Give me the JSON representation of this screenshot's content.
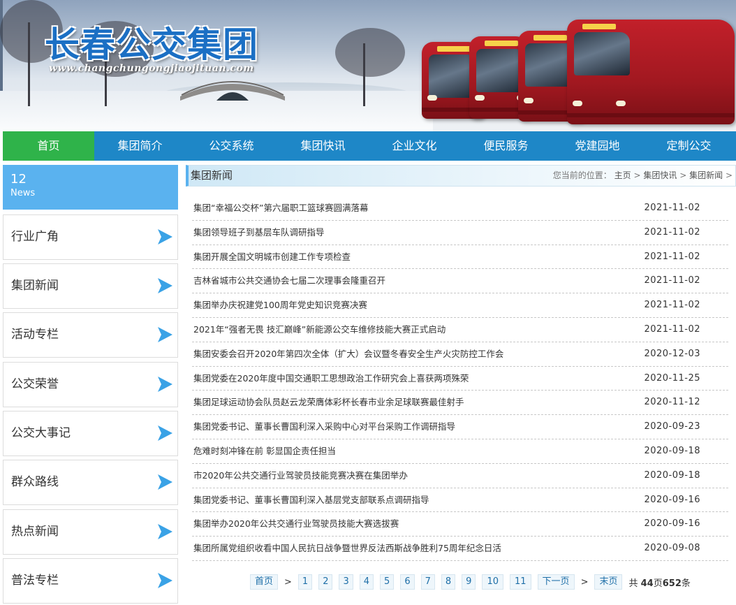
{
  "banner": {
    "logo_text": "长春公交集团",
    "url_text": "www.changchungongjiaojituan.com"
  },
  "nav": {
    "items": [
      {
        "label": "首页",
        "active": true
      },
      {
        "label": "集团简介",
        "active": false
      },
      {
        "label": "公交系统",
        "active": false
      },
      {
        "label": "集团快讯",
        "active": false
      },
      {
        "label": "企业文化",
        "active": false
      },
      {
        "label": "便民服务",
        "active": false
      },
      {
        "label": "党建园地",
        "active": false
      },
      {
        "label": "定制公交",
        "active": false
      }
    ],
    "active_color": "#2fb34a",
    "bar_color": "#1e87c7"
  },
  "sidebar": {
    "head_number": "12",
    "head_sub": "News",
    "items": [
      {
        "label": "行业广角",
        "icon": "arrow-right-icon"
      },
      {
        "label": "集团新闻",
        "icon": "arrow-right-icon"
      },
      {
        "label": "活动专栏",
        "icon": "arrow-right-icon"
      },
      {
        "label": "公交荣誉",
        "icon": "arrow-right-icon"
      },
      {
        "label": "公交大事记",
        "icon": "arrow-right-icon"
      },
      {
        "label": "群众路线",
        "icon": "arrow-right-icon"
      },
      {
        "label": "热点新闻",
        "icon": "arrow-right-icon"
      },
      {
        "label": "普法专栏",
        "icon": "arrow-right-icon"
      }
    ]
  },
  "main": {
    "title": "集团新闻",
    "breadcrumb": {
      "prefix": "您当前的位置：",
      "items": [
        "主页",
        "集团快讯",
        "集团新闻"
      ],
      "separator": ">"
    },
    "news": [
      {
        "title": "集团“幸福公交杯”第六届职工篮球赛圆满落幕",
        "date": "2021-11-02"
      },
      {
        "title": "集团领导班子到基层车队调研指导",
        "date": "2021-11-02"
      },
      {
        "title": "集团开展全国文明城市创建工作专项检查",
        "date": "2021-11-02"
      },
      {
        "title": "吉林省城市公共交通协会七届二次理事会隆重召开",
        "date": "2021-11-02"
      },
      {
        "title": "集团举办庆祝建党100周年党史知识竞赛决赛",
        "date": "2021-11-02"
      },
      {
        "title": "2021年“强者无畏 技汇巅峰”新能源公交车维修技能大赛正式启动",
        "date": "2021-11-02"
      },
      {
        "title": "集团安委会召开2020年第四次全体（扩大）会议暨冬春安全生产火灾防控工作会",
        "date": "2020-12-03"
      },
      {
        "title": "集团党委在2020年度中国交通职工思想政治工作研究会上喜获两项殊荣",
        "date": "2020-11-25"
      },
      {
        "title": "集团足球运动协会队员赵云龙荣膺体彩杯长春市业余足球联赛最佳射手",
        "date": "2020-11-12"
      },
      {
        "title": "集团党委书记、董事长曹国利深入采购中心对平台采购工作调研指导",
        "date": "2020-09-23"
      },
      {
        "title": "危难时刻冲锋在前 彰显国企责任担当",
        "date": "2020-09-18"
      },
      {
        "title": "市2020年公共交通行业驾驶员技能竞赛决赛在集团举办",
        "date": "2020-09-18"
      },
      {
        "title": "集团党委书记、董事长曹国利深入基层党支部联系点调研指导",
        "date": "2020-09-16"
      },
      {
        "title": "集团举办2020年公共交通行业驾驶员技能大赛选拔赛",
        "date": "2020-09-16"
      },
      {
        "title": "集团所属党组织收看中国人民抗日战争暨世界反法西斯战争胜利75周年纪念日活",
        "date": "2020-09-08"
      }
    ]
  },
  "pager": {
    "first": "首页",
    "sep": ">",
    "pages": [
      "1",
      "2",
      "3",
      "4",
      "5",
      "6",
      "7",
      "8",
      "9",
      "10",
      "11"
    ],
    "next": "下一页",
    "last": "末页",
    "total_prefix": "共",
    "total_pages": "44",
    "pages_unit": "页",
    "total_items": "652",
    "items_unit": "条"
  }
}
